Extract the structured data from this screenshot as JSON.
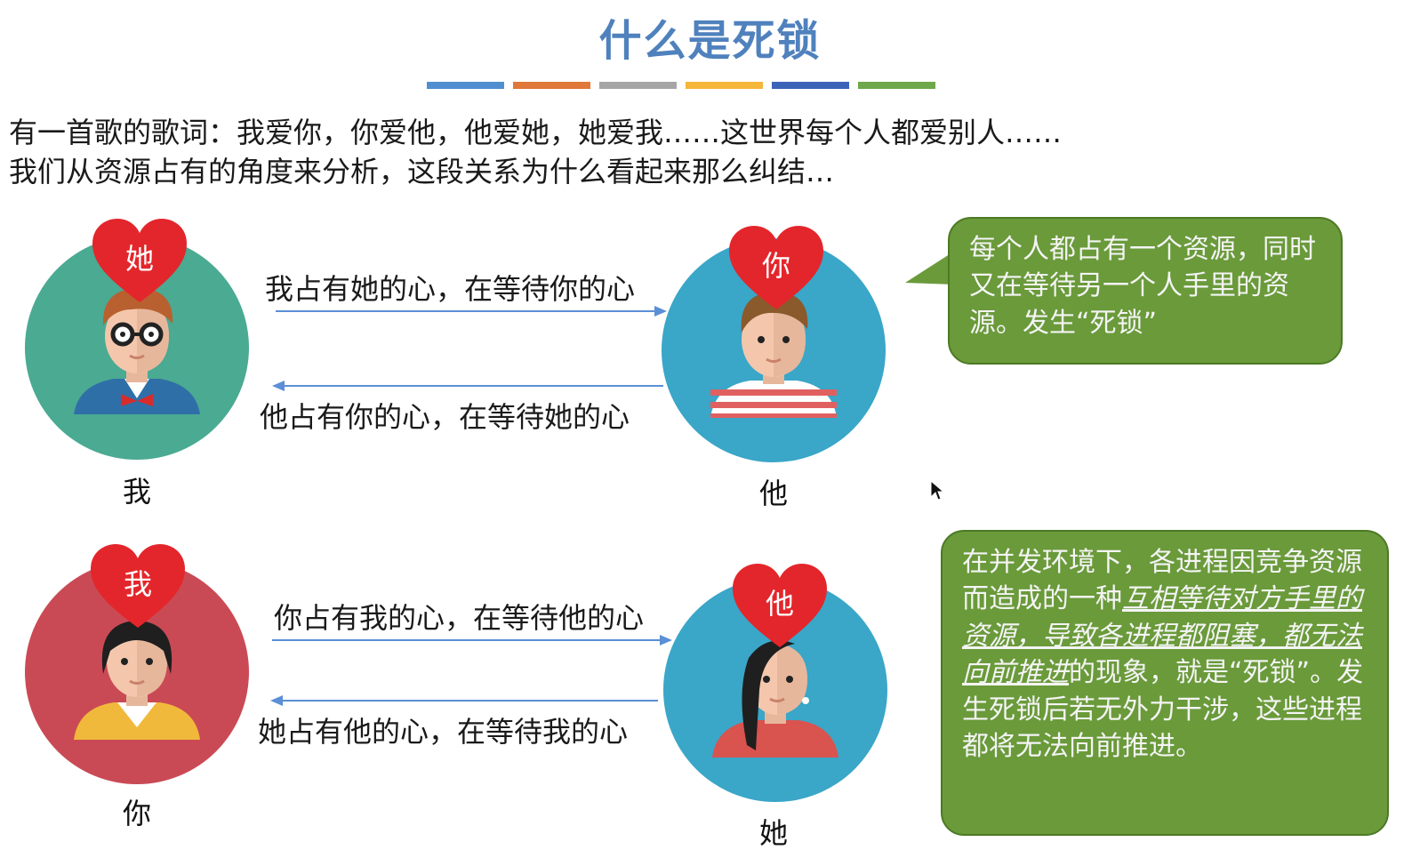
{
  "title": "什么是死锁",
  "accent_bars": [
    "#4f8fd0",
    "#e0783a",
    "#a6a6a6",
    "#f5b63a",
    "#3b63b8",
    "#6ea84a"
  ],
  "intro": {
    "line1": "有一首歌的歌词：我爱你，你爱他，他爱她，她爱我……这世界每个人都爱别人……",
    "line2": "我们从资源占有的角度来分析，这段关系为什么看起来那么纠结…"
  },
  "top_pair": {
    "left_name": "我",
    "left_heart": "她",
    "right_name": "他",
    "right_heart": "你",
    "arrow_right_label": "我占有她的心，在等待你的心",
    "arrow_left_label": "他占有你的心，在等待她的心"
  },
  "bottom_pair": {
    "left_name": "你",
    "left_heart": "我",
    "right_name": "她",
    "right_heart": "他",
    "arrow_right_label": "你占有我的心，在等待他的心",
    "arrow_left_label": "她占有他的心，在等待我的心"
  },
  "callout_top": "每个人都占有一个资源，同时又在等待另一个人手里的资源。发生“死锁”",
  "callout_bottom": {
    "part1": "在并发环境下，各进程因竞争资源而造成的一种",
    "emphasis": "互相等待对方手里的资源，导致各进程都阻塞，都无法向前推进",
    "part2": "的现象，就是“死锁”。发生死锁后若无外力干涉，这些进程都将无法向前推进。"
  },
  "colors": {
    "title": "#4f81bd",
    "heart": "#e3262b",
    "callout_bg": "#6a9a3a",
    "avatar_teal": "#4aaa92",
    "avatar_blue": "#3aa6c8",
    "avatar_red": "#c94a55",
    "arrow": "#5b8fd6"
  }
}
